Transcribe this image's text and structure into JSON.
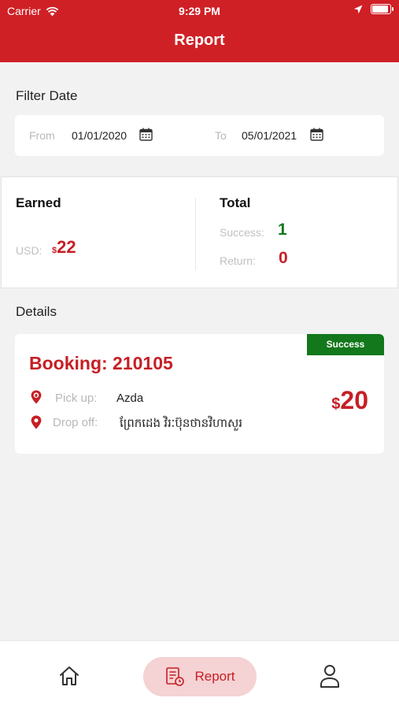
{
  "status_bar": {
    "carrier": "Carrier",
    "time": "9:29 PM"
  },
  "header": {
    "title": "Report"
  },
  "filter": {
    "section_label": "Filter Date",
    "from_label": "From",
    "from_value": "01/01/2020",
    "to_label": "To",
    "to_value": "05/01/2021"
  },
  "summary": {
    "earned_title": "Earned",
    "currency_label": "USD:",
    "currency_symbol": "$",
    "earned_value": "22",
    "total_title": "Total",
    "success_label": "Success:",
    "success_value": "1",
    "return_label": "Return:",
    "return_value": "0"
  },
  "details": {
    "section_label": "Details",
    "bookings": [
      {
        "title": "Booking: 210105",
        "status": "Success",
        "pickup_label": "Pick up:",
        "pickup_value": "Azda",
        "dropoff_label": "Drop off:",
        "dropoff_value": "ព្រែកដេង វិរៈប៊ុនថានវិហាសួរ",
        "price_symbol": "$",
        "price_value": "20"
      }
    ]
  },
  "bottom_nav": {
    "report_label": "Report"
  },
  "colors": {
    "brand_red": "#cf2026",
    "success_green": "#12781b",
    "value_red": "#c51f25"
  }
}
